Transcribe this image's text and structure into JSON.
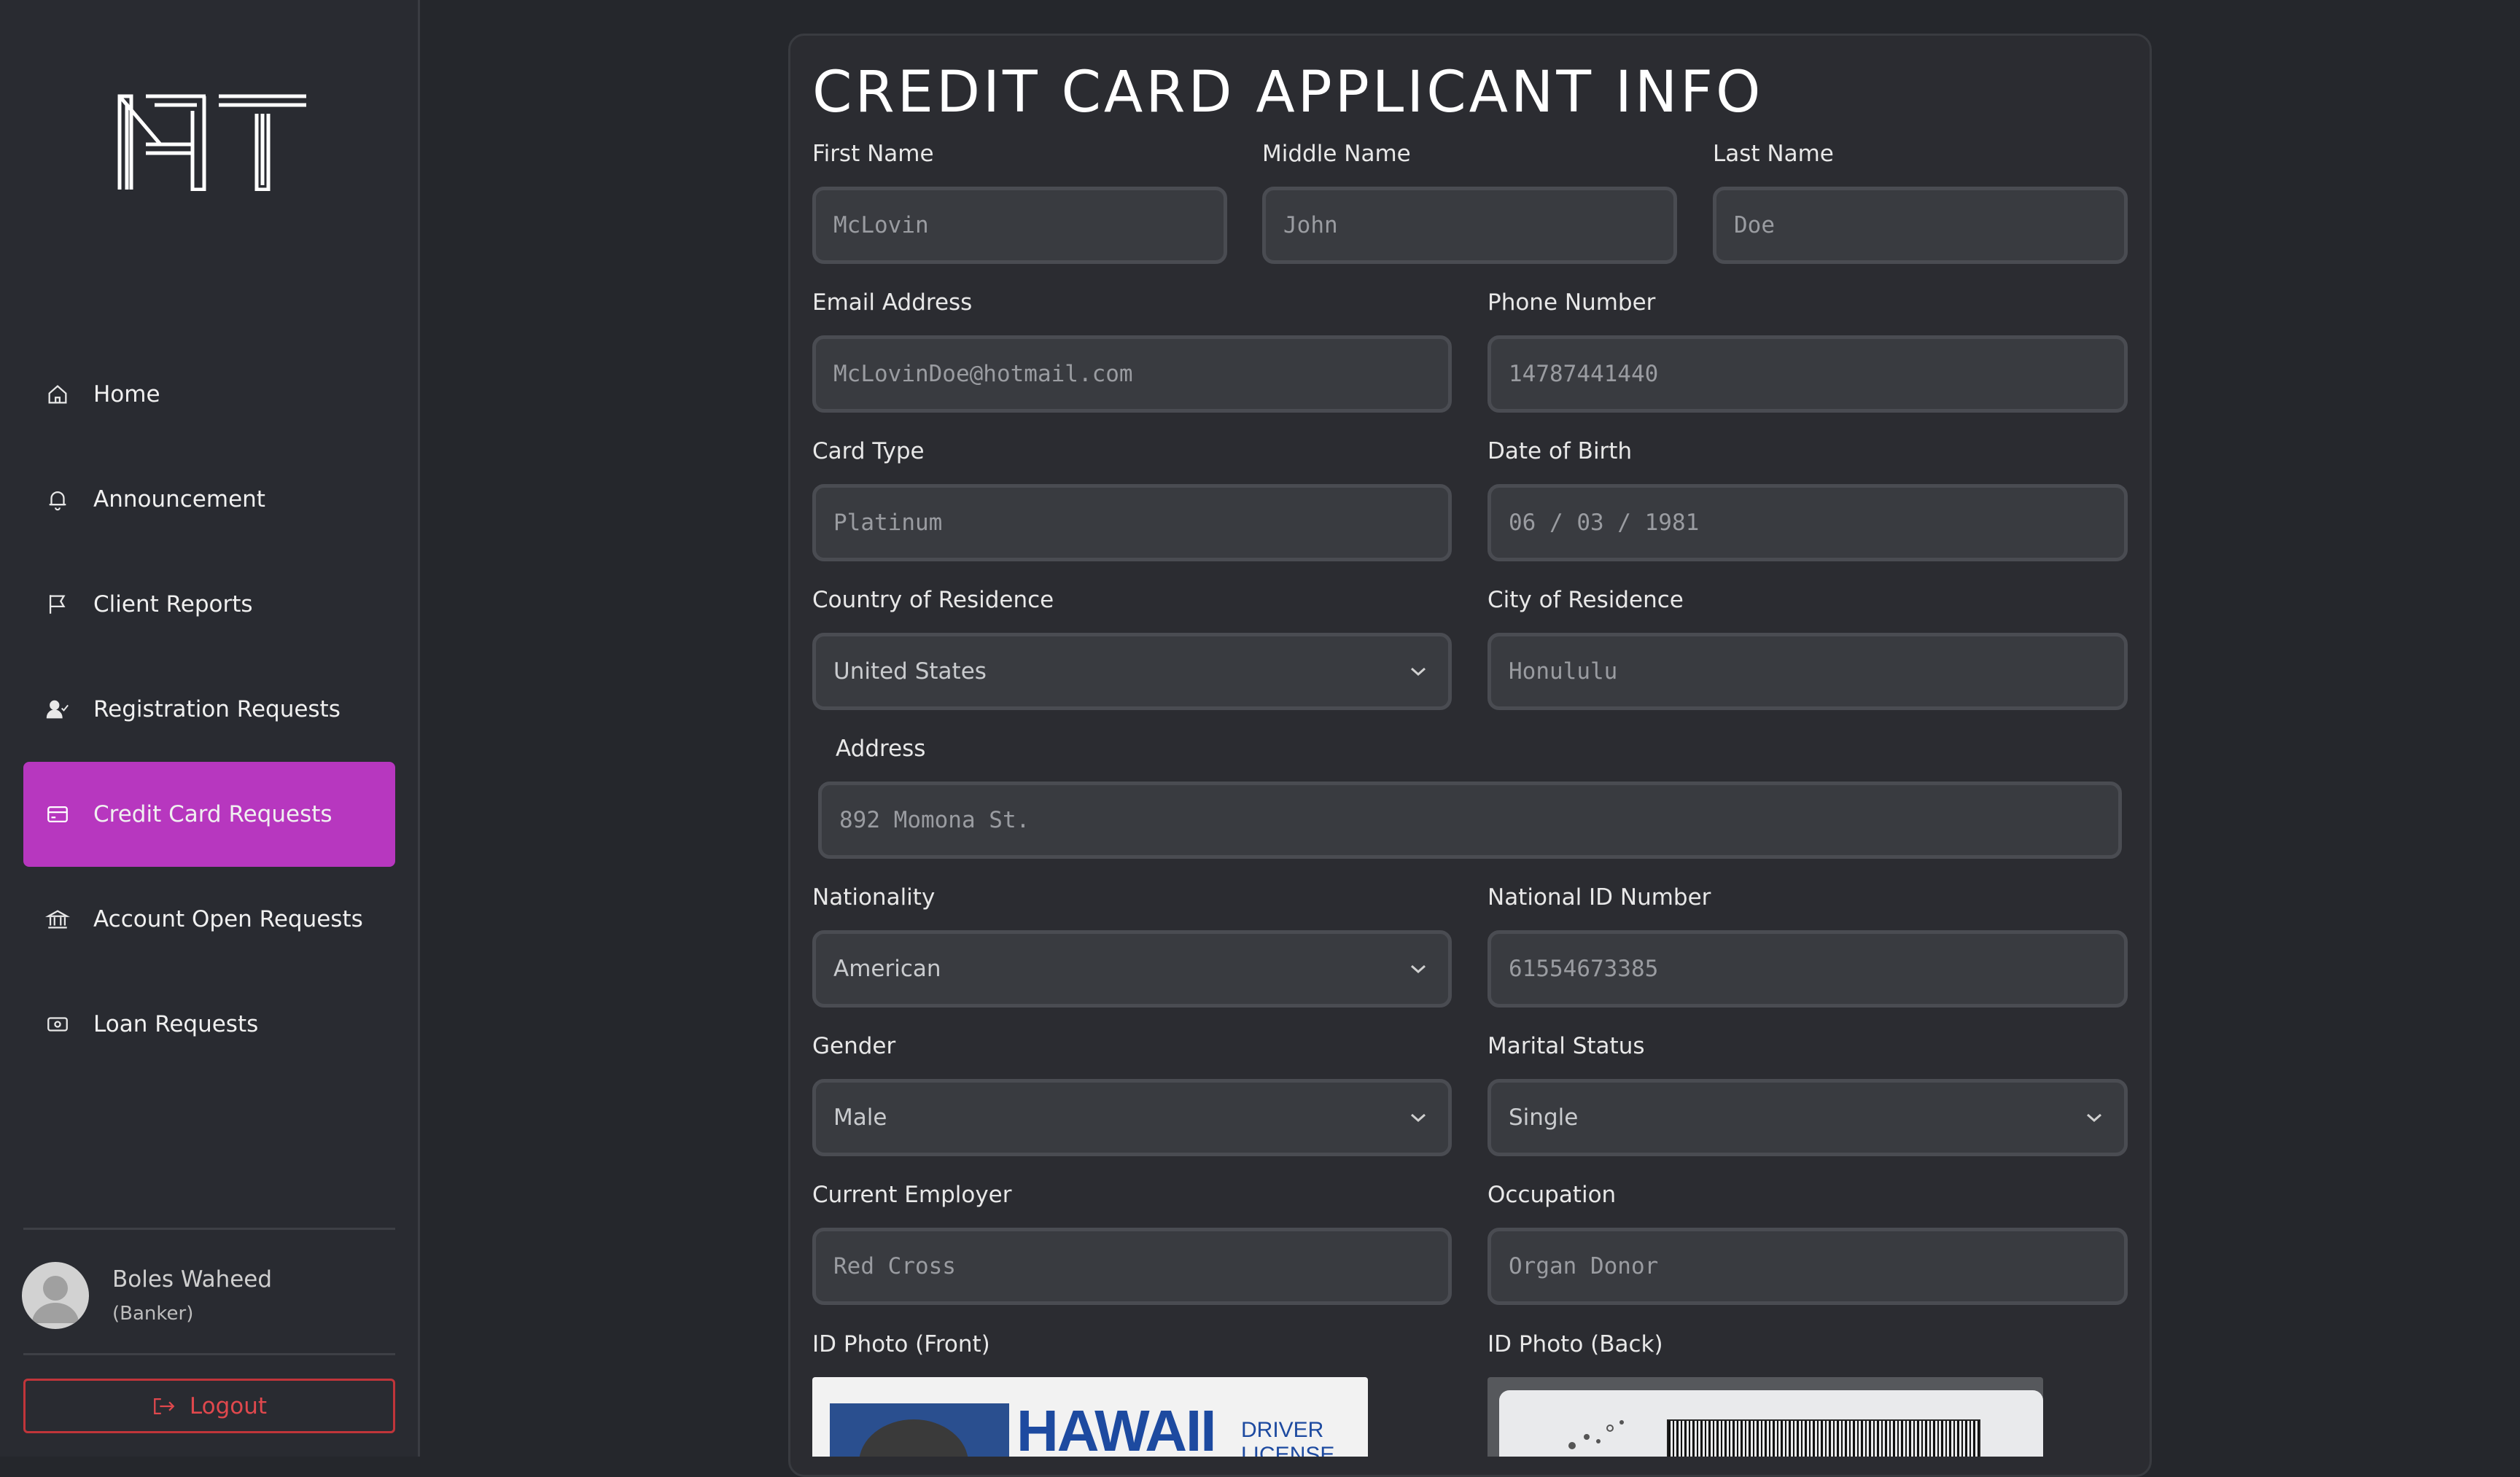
{
  "sidebar": {
    "logo_text": "NT",
    "items": [
      {
        "label": "Home",
        "icon": "home-icon"
      },
      {
        "label": "Announcement",
        "icon": "bell-icon"
      },
      {
        "label": "Client Reports",
        "icon": "flag-icon"
      },
      {
        "label": "Registration Requests",
        "icon": "user-check-icon"
      },
      {
        "label": "Credit Card Requests",
        "icon": "credit-card-icon",
        "active": true
      },
      {
        "label": "Account Open Requests",
        "icon": "bank-icon"
      },
      {
        "label": "Loan Requests",
        "icon": "cash-icon"
      }
    ],
    "user": {
      "name": "Boles Waheed",
      "role": "(Banker)"
    },
    "logout_label": "Logout",
    "accent": "#b737bf",
    "logout_color": "#e0484d"
  },
  "form": {
    "title": "CREDIT CARD APPLICANT INFO",
    "first_name": {
      "label": "First Name",
      "placeholder": "McLovin"
    },
    "middle_name": {
      "label": "Middle Name",
      "placeholder": "John"
    },
    "last_name": {
      "label": "Last Name",
      "placeholder": "Doe"
    },
    "email": {
      "label": "Email Address",
      "placeholder": "McLovinDoe@hotmail.com"
    },
    "phone": {
      "label": "Phone Number",
      "placeholder": "14787441440"
    },
    "card_type": {
      "label": "Card Type",
      "placeholder": "Platinum"
    },
    "dob": {
      "label": "Date of Birth",
      "placeholder": "06 / 03 / 1981"
    },
    "country": {
      "label": "Country of Residence",
      "value": "United States"
    },
    "city": {
      "label": "City of Residence",
      "placeholder": "Honululu"
    },
    "address": {
      "label": "Address",
      "placeholder": "892 Momona St."
    },
    "nationality": {
      "label": "Nationality",
      "value": "American"
    },
    "national_id": {
      "label": "National ID Number",
      "placeholder": "61554673385"
    },
    "gender": {
      "label": "Gender",
      "value": "Male"
    },
    "marital": {
      "label": "Marital Status",
      "value": "Single"
    },
    "employer": {
      "label": "Current Employer",
      "placeholder": "Red Cross"
    },
    "occupation": {
      "label": "Occupation",
      "placeholder": "Organ Donor"
    },
    "id_front": {
      "label": "ID Photo (Front)",
      "card_title": "HAWAII",
      "card_sub1": "DRIVER",
      "card_sub2": "LICENSE"
    },
    "id_back": {
      "label": "ID Photo (Back)"
    }
  }
}
